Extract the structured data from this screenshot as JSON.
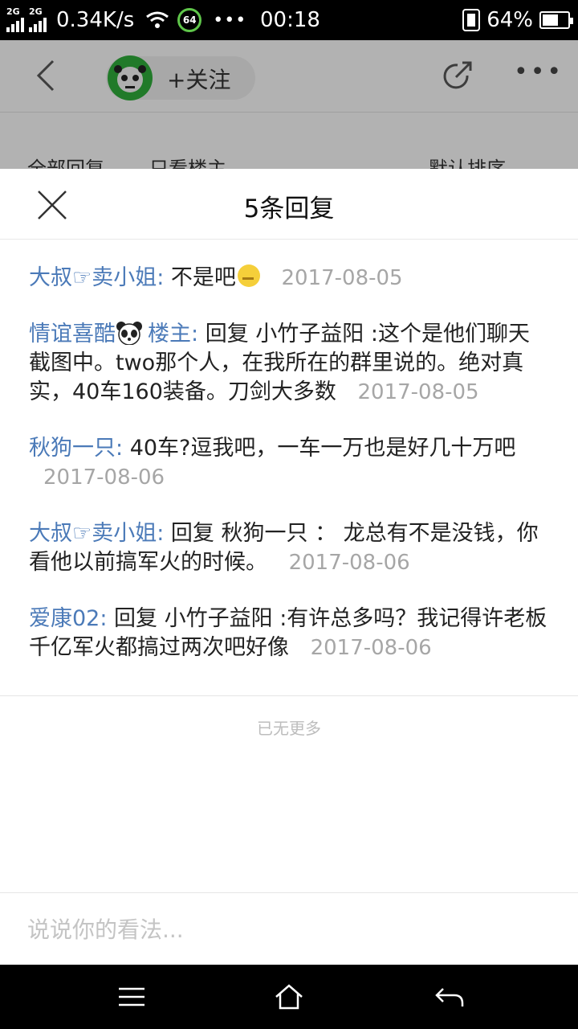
{
  "status_bar": {
    "sim1": "2G",
    "sim2": "2G",
    "speed": "0.34K/s",
    "badge": "64",
    "dots": "•••",
    "time": "00:18",
    "battery": "64%"
  },
  "post_header": {
    "follow_label": "+关注",
    "more_label": "•••",
    "sub_left": "全部回复",
    "sub_mid": "只看楼主",
    "sub_right": "默认排序"
  },
  "sheet": {
    "title": "5条回复",
    "op_tag": "楼主:",
    "replies": [
      {
        "user": "大叔☞卖小姐:",
        "text": "不是吧",
        "date": "2017-08-05"
      },
      {
        "user": "情谊喜酷",
        "text": "回复 小竹子益阳 :这个是他们聊天截图中。two那个人，在我所在的群里说的。绝对真实，40车160装备。刀剑大多数",
        "date": "2017-08-05"
      },
      {
        "user": "秋狗一只:",
        "text": "40车?逗我吧，一车一万也是好几十万吧",
        "date": "2017-08-06"
      },
      {
        "user": "大叔☞卖小姐:",
        "text": "回复 秋狗一只 ： 龙总有不是没钱，你看他以前搞军火的时候。",
        "date": "2017-08-06"
      },
      {
        "user": "爱康02:",
        "text": "回复 小竹子益阳 :有许总多吗？我记得许老板千亿军火都搞过两次吧好像",
        "date": "2017-08-06"
      }
    ],
    "no_more": "已无更多",
    "input_placeholder": "说说你的看法..."
  },
  "colors": {
    "username": "#4b7ab8",
    "date": "#a6a6a6",
    "accent_green": "#2faa3a"
  },
  "icons": [
    "back-chevron-icon",
    "share-icon",
    "close-icon",
    "menu-icon",
    "home-icon",
    "back-arrow-icon",
    "panda-emoji-icon",
    "sweat-emoji-icon"
  ]
}
